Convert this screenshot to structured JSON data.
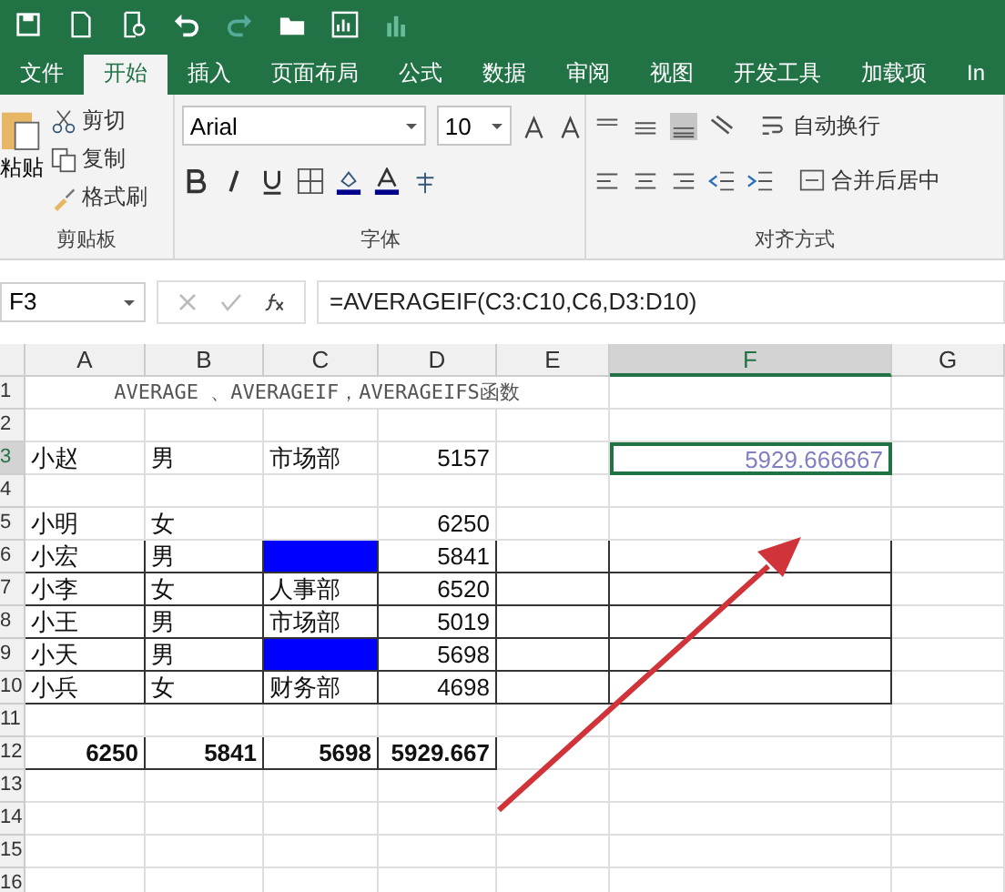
{
  "tabs": [
    {
      "label": "文件",
      "selected": false
    },
    {
      "label": "开始",
      "selected": true
    },
    {
      "label": "插入",
      "selected": false
    },
    {
      "label": "页面布局",
      "selected": false
    },
    {
      "label": "公式",
      "selected": false
    },
    {
      "label": "数据",
      "selected": false
    },
    {
      "label": "审阅",
      "selected": false
    },
    {
      "label": "视图",
      "selected": false
    },
    {
      "label": "开发工具",
      "selected": false
    },
    {
      "label": "加载项",
      "selected": false
    },
    {
      "label": "In",
      "selected": false
    }
  ],
  "clipboard": {
    "paste": "粘贴",
    "cut": "剪切",
    "copy": "复制",
    "painter": "格式刷",
    "label": "剪贴板"
  },
  "font": {
    "name": "Arial",
    "size": "10",
    "label": "字体"
  },
  "alignment": {
    "wrap": "自动换行",
    "merge": "合并后居中",
    "label": "对齐方式"
  },
  "name_box": "F3",
  "formula": "=AVERAGEIF(C3:C10,C6,D3:D10)",
  "columns": [
    {
      "label": "A",
      "selected": false
    },
    {
      "label": "B",
      "selected": false
    },
    {
      "label": "C",
      "selected": false
    },
    {
      "label": "D",
      "selected": false
    },
    {
      "label": "E",
      "selected": false
    },
    {
      "label": "F",
      "selected": true
    },
    {
      "label": "G",
      "selected": false
    }
  ],
  "rows": [
    {
      "number": "1",
      "selected": false,
      "bordered": false,
      "cells": [
        {
          "text": "AVERAGE 、AVERAGEIF，AVERAGEIFS函数",
          "kind": "merged"
        },
        null,
        null
      ]
    },
    {
      "number": "2",
      "selected": false,
      "bordered": false,
      "cells": []
    },
    {
      "number": "3",
      "selected": true,
      "bordered": false,
      "cells": [
        "小赵",
        "男",
        "市场部",
        {
          "text": "5157",
          "num": true
        },
        null,
        {
          "text": "5929.666667",
          "num": true,
          "selected": true
        },
        null
      ]
    },
    {
      "number": "4",
      "selected": false,
      "bordered": false,
      "cells": []
    },
    {
      "number": "5",
      "selected": false,
      "bordered": false,
      "cells": [
        "小明",
        "女",
        null,
        {
          "text": "6250",
          "num": true
        },
        null,
        null,
        null
      ]
    },
    {
      "number": "6",
      "selected": false,
      "bordered": true,
      "cells": [
        "小宏",
        "男",
        {
          "highlighted": true
        },
        {
          "text": "5841",
          "num": true
        },
        null,
        null,
        null
      ]
    },
    {
      "number": "7",
      "selected": false,
      "bordered": true,
      "cells": [
        "小李",
        "女",
        "人事部",
        {
          "text": "6520",
          "num": true
        },
        null,
        null,
        null
      ]
    },
    {
      "number": "8",
      "selected": false,
      "bordered": true,
      "cells": [
        "小王",
        "男",
        "市场部",
        {
          "text": "5019",
          "num": true
        },
        null,
        null,
        null
      ]
    },
    {
      "number": "9",
      "selected": false,
      "bordered": true,
      "cells": [
        "小天",
        "男",
        {
          "highlighted": true
        },
        {
          "text": "5698",
          "num": true
        },
        null,
        null,
        null
      ]
    },
    {
      "number": "10",
      "selected": false,
      "bordered": true,
      "cells": [
        "小兵",
        "女",
        "财务部",
        {
          "text": "4698",
          "num": true
        },
        null,
        null,
        null
      ]
    },
    {
      "number": "11",
      "selected": false,
      "bordered": false,
      "cells": []
    },
    {
      "number": "12",
      "selected": false,
      "bordered": true,
      "bold": true,
      "cells": [
        {
          "text": "6250",
          "num": true
        },
        {
          "text": "5841",
          "num": true
        },
        {
          "text": "5698",
          "num": true
        },
        {
          "text": "5929.667",
          "num": true
        },
        null,
        null,
        null
      ]
    },
    {
      "number": "13",
      "selected": false,
      "bordered": false,
      "cells": []
    },
    {
      "number": "14",
      "selected": false,
      "bordered": false,
      "cells": []
    },
    {
      "number": "15",
      "selected": false,
      "bordered": false,
      "cells": []
    },
    {
      "number": "16",
      "selected": false,
      "bordered": false,
      "cells": []
    }
  ]
}
